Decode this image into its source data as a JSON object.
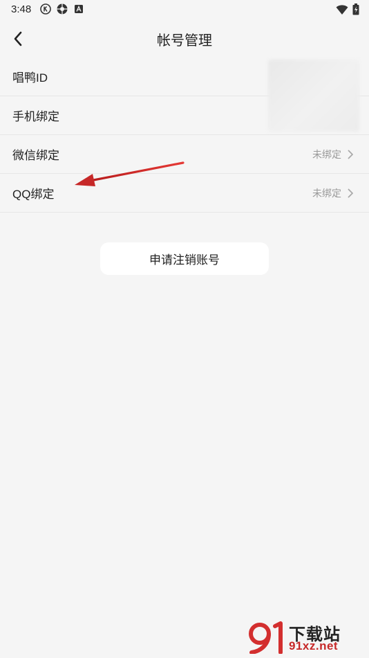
{
  "status_bar": {
    "time": "3:48",
    "left_icons": [
      "k-circle-icon",
      "shutter-icon",
      "a-box-icon"
    ],
    "right_icons": [
      "wifi-icon",
      "battery-charging-icon"
    ]
  },
  "header": {
    "title": "帐号管理",
    "back_icon": "chevron-left-icon"
  },
  "rows": [
    {
      "label": "唱鸭ID",
      "status": ""
    },
    {
      "label": "手机绑定",
      "status": ""
    },
    {
      "label": "微信绑定",
      "status": "未绑定"
    },
    {
      "label": "QQ绑定",
      "status": "未绑定"
    }
  ],
  "deregister_button": "申请注销账号",
  "watermark": {
    "title": "下载站",
    "url": "91xz.net"
  },
  "colors": {
    "background": "#f5f5f5",
    "text": "#222222",
    "muted": "#999999",
    "annotation_arrow": "#d32f2f"
  }
}
